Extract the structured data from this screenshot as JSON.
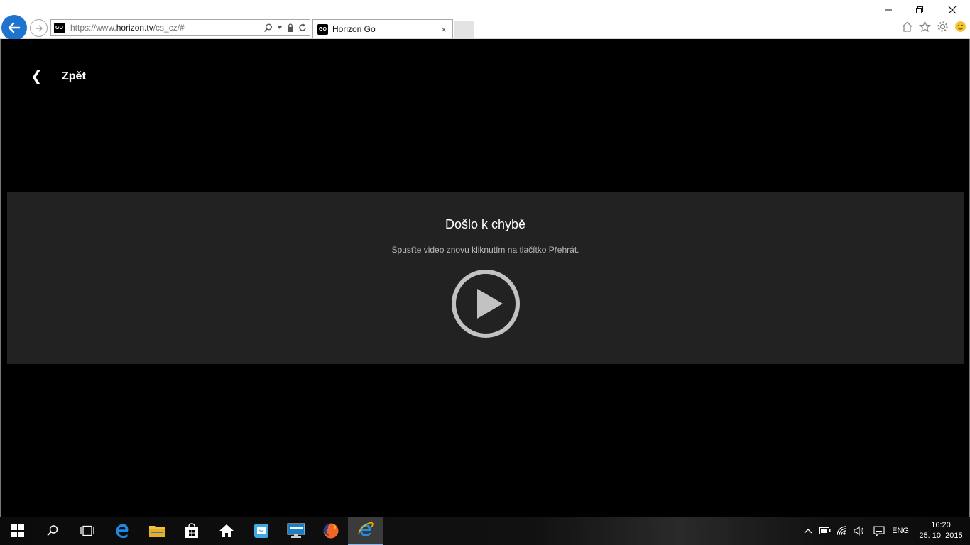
{
  "browser": {
    "url_prefix": "https://www.",
    "url_host": "horizon.tv",
    "url_path": "/cs_cz/#",
    "favicon_text": "GO",
    "tab_title": "Horizon Go",
    "tab_close": "×"
  },
  "page": {
    "back_label": "Zpět",
    "back_chevron": "❮",
    "error_title": "Došlo k chybě",
    "error_message": "Spusťte video znovu kliknutím na tlačítko Přehrát."
  },
  "taskbar": {
    "language": "ENG",
    "time": "16:20",
    "date": "25. 10. 2015"
  },
  "colors": {
    "back_button": "#1e73cf",
    "player_bg": "#222222",
    "play_icon": "#c2c2c2"
  }
}
